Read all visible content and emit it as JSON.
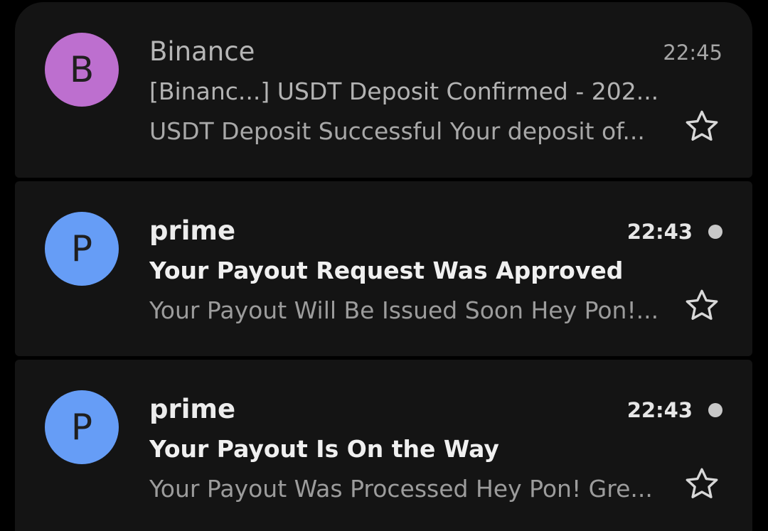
{
  "colors": {
    "background": "#000000",
    "card": "#141414",
    "unread_dot": "#c8c8c8"
  },
  "emails": [
    {
      "avatar_letter": "B",
      "avatar_color": "#bd6fcf",
      "sender": "Binance",
      "time": "22:45",
      "subject": "[Binanc...] USDT Deposit Confirmed - 202...",
      "snippet": "USDT Deposit Successful Your deposit of...",
      "unread": false,
      "star_icon": "star-outline-icon"
    },
    {
      "avatar_letter": "P",
      "avatar_color": "#669df6",
      "sender": "prime",
      "time": "22:43",
      "subject": "Your Payout Request Was Approved",
      "snippet": "Your Payout Will Be Issued Soon Hey Pon!...",
      "unread": true,
      "star_icon": "star-outline-icon"
    },
    {
      "avatar_letter": "P",
      "avatar_color": "#669df6",
      "sender": "prime",
      "time": "22:43",
      "subject": "Your Payout Is On the Way",
      "snippet": "Your Payout Was Processed Hey Pon! Gre...",
      "unread": true,
      "star_icon": "star-outline-icon"
    }
  ]
}
